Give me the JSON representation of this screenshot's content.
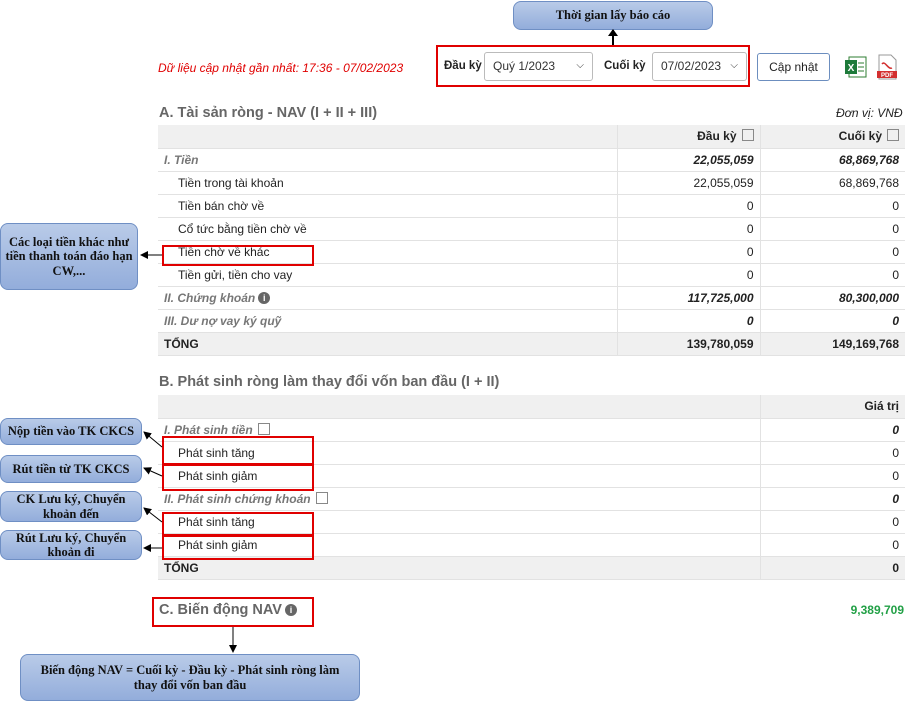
{
  "top_callout": "Thời gian lấy báo cáo",
  "last_update": "Dữ liệu cập nhật gần nhất: 17:36 - 07/02/2023",
  "filter": {
    "from_label": "Đầu kỳ",
    "from_value": "Quý 1/2023",
    "to_label": "Cuối kỳ",
    "to_value": "07/02/2023",
    "update_button": "Cập nhật"
  },
  "section_a": {
    "title": "A. Tài sản ròng - NAV (I + II + III)",
    "unit": "Đơn vị: VNĐ",
    "headers": [
      "Đầu kỳ",
      "Cuối kỳ"
    ],
    "rows": [
      {
        "label": "I. Tiền",
        "start": "22,055,059",
        "end": "68,869,768"
      },
      {
        "label": "Tiền trong tài khoản",
        "start": "22,055,059",
        "end": "68,869,768"
      },
      {
        "label": "Tiền bán chờ về",
        "start": "0",
        "end": "0"
      },
      {
        "label": "Cổ tức bằng tiền chờ về",
        "start": "0",
        "end": "0"
      },
      {
        "label": "Tiền chờ về khác",
        "start": "0",
        "end": "0"
      },
      {
        "label": "Tiền gửi, tiền cho vay",
        "start": "0",
        "end": "0"
      },
      {
        "label": "II. Chứng khoán",
        "start": "117,725,000",
        "end": "80,300,000"
      },
      {
        "label": "III. Dư nợ vay ký quỹ",
        "start": "0",
        "end": "0"
      },
      {
        "label": "TỔNG",
        "start": "139,780,059",
        "end": "149,169,768"
      }
    ]
  },
  "section_b": {
    "title": "B. Phát sinh ròng làm thay đổi vốn ban đầu (I + II)",
    "header": "Giá trị",
    "rows": [
      {
        "label": "I. Phát sinh tiền",
        "value": "0"
      },
      {
        "label": "Phát sinh tăng",
        "value": "0"
      },
      {
        "label": "Phát sinh giảm",
        "value": "0"
      },
      {
        "label": "II. Phát sinh chứng khoán",
        "value": "0"
      },
      {
        "label": "Phát sinh tăng",
        "value": "0"
      },
      {
        "label": "Phát sinh giảm",
        "value": "0"
      },
      {
        "label": "TỔNG",
        "value": "0"
      }
    ]
  },
  "section_c": {
    "title": "C. Biến động NAV",
    "value": "9,389,709"
  },
  "callouts": {
    "other_cash": "Các loại tiền khác như tiền thanh toán đáo hạn CW,...",
    "deposit": "Nộp tiền vào TK CKCS",
    "withdraw": "Rút tiền từ TK CKCS",
    "custody_in": "CK Lưu ký, Chuyển khoản đến",
    "custody_out": "Rút Lưu ký, Chuyển khoản đi",
    "formula": "Biến động NAV = Cuối kỳ - Đầu kỳ - Phát sinh ròng làm thay đổi vốn ban đầu"
  },
  "colors": {
    "accent_red": "#e00000",
    "nav_green": "#22a046",
    "callout_blue": "#a7bde3"
  }
}
